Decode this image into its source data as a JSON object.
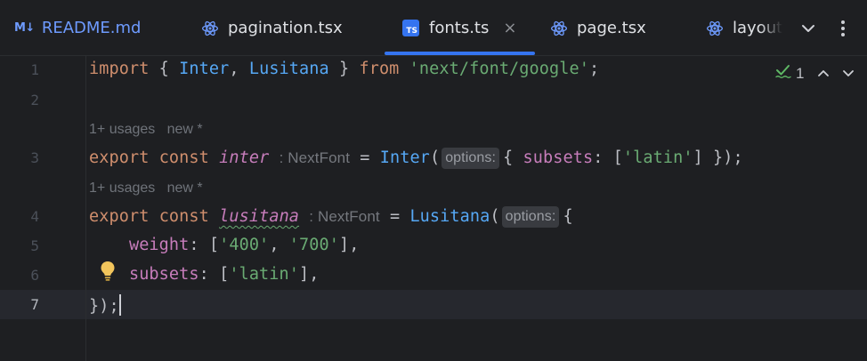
{
  "tabs": [
    {
      "badge": "M↓",
      "label": "README.md",
      "icon": "markdown-icon"
    },
    {
      "label": "pagination.tsx",
      "icon": "react-icon"
    },
    {
      "badge": "TS",
      "label": "fonts.ts",
      "icon": "typescript-icon",
      "active": true,
      "close": "×"
    },
    {
      "label": "page.tsx",
      "icon": "react-icon"
    },
    {
      "label": "layout",
      "icon": "react-icon"
    }
  ],
  "tabbar_icons": {
    "dropdown": "chevron-down-icon",
    "more": "more-vertical-icon"
  },
  "inspections": {
    "count": "1",
    "icon": "checkmark-icon"
  },
  "editor": {
    "line_numbers": [
      "1",
      "2",
      "3",
      "4",
      "5",
      "6",
      "7"
    ],
    "current_line": "7",
    "usages_hint_1": "1+ usages   new *",
    "usages_hint_2": "1+ usages   new *",
    "line1": {
      "kw_import": "import",
      "open_brace": " { ",
      "name_inter": "Inter",
      "comma": ", ",
      "name_lusitana": "Lusitana",
      "close_brace": " } ",
      "kw_from": "from",
      "space": " ",
      "module": "'next/font/google'",
      "semicolon": ";"
    },
    "line3": {
      "kw_export": "export",
      "kw_const": "const",
      "var": "inter",
      "type_hint": ": NextFont",
      "eq": " = ",
      "fn": "Inter",
      "open_paren": "(",
      "param_hint": "options:",
      "rest_open": "{ ",
      "prop": "subsets",
      "colon": ": [",
      "str": "'latin'",
      "rest_close": "] });"
    },
    "line4": {
      "kw_export": "export",
      "kw_const": "const",
      "var": "lusitana",
      "type_hint": ": NextFont",
      "eq": " = ",
      "fn": "Lusitana",
      "open_paren": "(",
      "param_hint": "options:",
      "rest_open": "{"
    },
    "line5": {
      "indent": "    ",
      "prop": "weight",
      "colon": ": [",
      "str1": "'400'",
      "sep": ", ",
      "str2": "'700'",
      "close": "],"
    },
    "line6": {
      "indent": "    ",
      "prop": "subsets",
      "colon": ": [",
      "str": "'latin'",
      "close": "],"
    },
    "line7": {
      "text": "});"
    }
  },
  "colors": {
    "background": "#1e1f22",
    "keyword": "#cf8e6d",
    "string": "#6aab73",
    "function": "#56a8f5",
    "property": "#c77dbb",
    "accent": "#3574f0"
  }
}
